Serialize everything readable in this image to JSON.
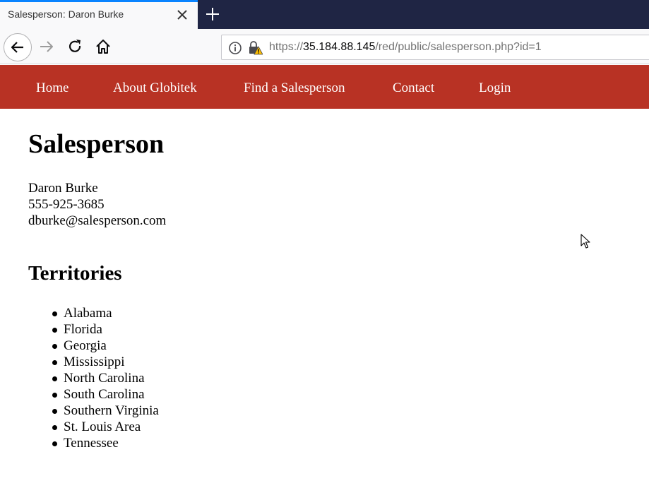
{
  "browser": {
    "tab_title": "Salesperson: Daron Burke",
    "url_prefix": "https://",
    "url_host": "35.184.88.145",
    "url_path": "/red/public/salesperson.php?id=1",
    "icons": {
      "close": "close-icon",
      "new_tab": "plus-icon",
      "back": "back-arrow-icon",
      "forward": "forward-arrow-icon",
      "reload": "reload-icon",
      "home": "home-icon",
      "info": "info-icon",
      "lock": "insecure-lock-icon"
    },
    "colors": {
      "tabbar": "#1f2544",
      "tab_accent": "#0a84ff"
    }
  },
  "site": {
    "nav": {
      "color": "#b83224",
      "items": [
        {
          "label": "Home"
        },
        {
          "label": "About Globitek"
        },
        {
          "label": "Find a Salesperson"
        },
        {
          "label": "Contact"
        },
        {
          "label": "Login"
        }
      ]
    },
    "page_title": "Salesperson",
    "salesperson": {
      "name": "Daron Burke",
      "phone": "555-925-3685",
      "email": "dburke@salesperson.com"
    },
    "territories_title": "Territories",
    "territories": [
      "Alabama",
      "Florida",
      "Georgia",
      "Mississippi",
      "North Carolina",
      "South Carolina",
      "Southern Virginia",
      "St. Louis Area",
      "Tennessee"
    ]
  }
}
